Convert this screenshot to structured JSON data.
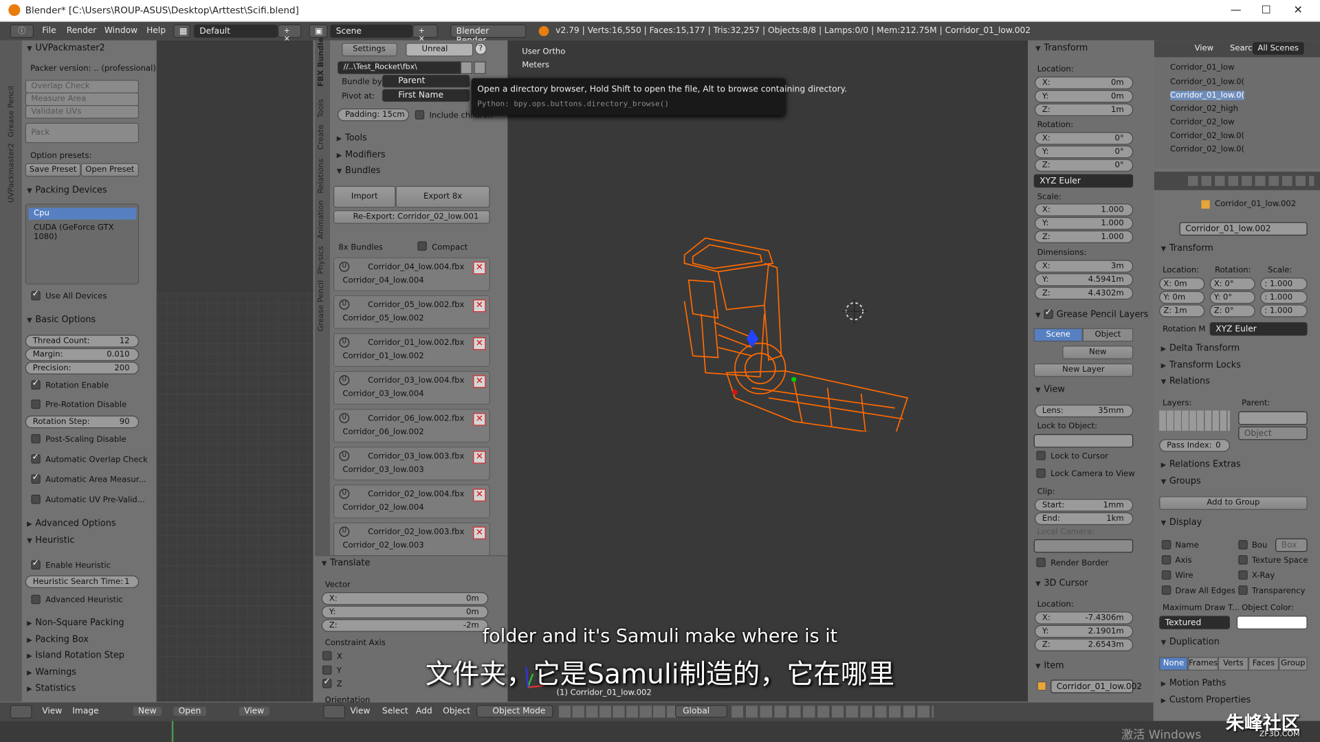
{
  "window": {
    "title": "Blender* [C:\\Users\\ROUP-ASUS\\Desktop\\Arttest\\Scifi.blend]",
    "min": "—",
    "max": "☐",
    "close": "✕"
  },
  "infobar": {
    "menus": [
      "File",
      "Render",
      "Window",
      "Help"
    ],
    "layout": "Default",
    "scene": "Scene",
    "engine": "Blender Render",
    "stats": "v2.79 | Verts:16,550 | Faces:15,177 | Tris:32,257 | Objects:8/8 | Lamps:0/0 | Mem:212.75M | Corridor_01_low.002"
  },
  "left_tabs": [
    "Grease Pencil",
    "UVPackmaster2"
  ],
  "uvp": {
    "title": "UVPackmaster2",
    "version": "Packer version: .. (professional)",
    "btns": [
      "Overlap Check",
      "Measure Area",
      "Validate UVs",
      "Pack"
    ],
    "presets_label": "Option presets:",
    "save_preset": "Save Preset",
    "open_preset": "Open Preset",
    "packing_devices": "Packing Devices",
    "devices": [
      "Cpu",
      "CUDA (GeForce GTX 1080)"
    ],
    "use_all": "Use All Devices",
    "basic": "Basic Options",
    "thread_label": "Thread Count:",
    "thread": "12",
    "margin_label": "Margin:",
    "margin": "0.010",
    "precision_label": "Precision:",
    "precision": "200",
    "rot_enable": "Rotation Enable",
    "prerot": "Pre-Rotation Disable",
    "rotstep_label": "Rotation Step:",
    "rotstep": "90",
    "postscale": "Post-Scaling Disable",
    "auto_overlap": "Automatic Overlap Check",
    "auto_area": "Automatic Area Measur...",
    "auto_uv": "Automatic UV Pre-Valid...",
    "advanced": "Advanced Options",
    "heuristic": "Heuristic",
    "enable_heur": "Enable Heuristic",
    "heur_time_label": "Heuristic Search Time:",
    "heur_time": "1",
    "adv_heur": "Advanced Heuristic",
    "collapsed": [
      "Non-Square Packing",
      "Packing Box",
      "Island Rotation Step",
      "Warnings",
      "Statistics"
    ]
  },
  "mid_tabs": [
    "FBX Bundle",
    "Tools",
    "Create",
    "Relations",
    "Animation",
    "Physics",
    "Grease Pencil"
  ],
  "fbx": {
    "settings": "Settings",
    "target": "Unreal",
    "path": "//..\\Test_Rocket\\fbx\\",
    "bundle_by_label": "Bundle by:",
    "bundle_by": "Parent",
    "pivot_label": "Pivot at:",
    "pivot": "First Name",
    "padding": "Padding: 15cm",
    "include_children": "Include children",
    "tools": "Tools",
    "modifiers": "Modifiers",
    "bundles": "Bundles",
    "import": "Import",
    "export": "Export 8x",
    "reexport": "Re-Export: Corridor_02_low.001",
    "count": "8x Bundles",
    "compact": "Compact",
    "items": [
      {
        "file": "Corridor_04_low.004.fbx",
        "obj": "Corridor_04_low.004"
      },
      {
        "file": "Corridor_05_low.002.fbx",
        "obj": "Corridor_05_low.002"
      },
      {
        "file": "Corridor_01_low.002.fbx",
        "obj": "Corridor_01_low.002"
      },
      {
        "file": "Corridor_03_low.004.fbx",
        "obj": "Corridor_03_low.004"
      },
      {
        "file": "Corridor_06_low.002.fbx",
        "obj": "Corridor_06_low.002"
      },
      {
        "file": "Corridor_03_low.003.fbx",
        "obj": "Corridor_03_low.003"
      },
      {
        "file": "Corridor_02_low.004.fbx",
        "obj": "Corridor_02_low.004"
      },
      {
        "file": "Corridor_02_low.003.fbx",
        "obj": "Corridor_02_low.003"
      }
    ]
  },
  "translate": {
    "title": "Translate",
    "vector": "Vector",
    "x_label": "X:",
    "x": "0m",
    "y_label": "Y:",
    "y": "0m",
    "z_label": "Z:",
    "z": "-2m",
    "constraint": "Constraint Axis",
    "cx": "X",
    "cy": "Y",
    "cz": "Z",
    "orientation": "Orientation"
  },
  "tooltip": {
    "text": "Open a directory browser, Hold Shift to open the file, Alt to browse containing directory.",
    "python": "Python: bpy.ops.buttons.directory_browse()"
  },
  "viewport": {
    "view_name": "User Ortho",
    "units": "Meters",
    "object_label": "(1) Corridor_01_low.002"
  },
  "subtitles": {
    "en": "folder and it's Samuli make where is it",
    "zh": "文件夹，它是Samuli制造的，它在哪里"
  },
  "npanel": {
    "transform": "Transform",
    "location": "Location:",
    "loc": [
      "0m",
      "0m",
      "1m"
    ],
    "rotation": "Rotation:",
    "rot": [
      "0°",
      "0°",
      "0°"
    ],
    "rot_mode": "XYZ Euler",
    "scale": "Scale:",
    "scl": [
      "1.000",
      "1.000",
      "1.000"
    ],
    "dimensions": "Dimensions:",
    "dim": [
      "3m",
      "4.5941m",
      "4.4302m"
    ],
    "gp_layers": "Grease Pencil Layers",
    "gp_scene": "Scene",
    "gp_object": "Object",
    "gp_new": "New",
    "gp_new_layer": "New Layer",
    "view": "View",
    "lens": "Lens:",
    "lens_v": "35mm",
    "lock_obj": "Lock to Object:",
    "lock_cursor": "Lock to Cursor",
    "lock_cam": "Lock Camera to View",
    "clip": "Clip:",
    "clip_start": "Start:",
    "clip_start_v": "1mm",
    "clip_end": "End:",
    "clip_end_v": "1km",
    "local_cam": "Local Camera:",
    "render_border": "Render Border",
    "cursor": "3D Cursor",
    "cursor_loc": "Location:",
    "cur": [
      "-7.4306m",
      "2.1901m",
      "2.6543m"
    ],
    "item": "Item",
    "item_name": "Corridor_01_low.002"
  },
  "outliner": {
    "view": "View",
    "search": "Search",
    "all_scenes": "All Scenes",
    "items": [
      "Corridor_01_low",
      "Corridor_01_low.0(",
      "Corridor_01_low.0(",
      "Corridor_02_high",
      "Corridor_02_low",
      "Corridor_02_low.0(",
      "Corridor_02_low.0("
    ]
  },
  "props": {
    "breadcrumb": "Corridor_01_low.002",
    "name": "Corridor_01_low.002",
    "transform": "Transform",
    "location": "Location:",
    "rotation": "Rotation:",
    "scale": "Scale:",
    "loc": [
      "X: 0m",
      "Y: 0m",
      "Z: 1m"
    ],
    "rot": [
      "X: 0°",
      "Y: 0°",
      "Z: 0°"
    ],
    "scl": [
      ": 1.000",
      ": 1.000",
      ": 1.000"
    ],
    "rotmode_label": "Rotation M",
    "rotmode": "XYZ Euler",
    "delta": "Delta Transform",
    "locks": "Transform Locks",
    "relations": "Relations",
    "layers": "Layers:",
    "parent": "Parent:",
    "parent_type": "Object",
    "pass_index": "Pass Index:",
    "pass_index_v": "0",
    "rel_extras": "Relations Extras",
    "groups": "Groups",
    "add_group": "Add to Group",
    "display": "Display",
    "d_name": "Name",
    "d_bou": "Bou",
    "d_box": "Box",
    "d_axis": "Axis",
    "d_texspace": "Texture Space",
    "d_wire": "Wire",
    "d_xray": "X-Ray",
    "d_alledges": "Draw All Edges",
    "d_transp": "Transparency",
    "maxdraw": "Maximum Draw T...",
    "objcolor": "Object Color:",
    "drawtype": "Textured",
    "duplication": "Duplication",
    "dup_tabs": [
      "None",
      "Frames",
      "Verts",
      "Faces",
      "Group"
    ],
    "motion": "Motion Paths",
    "custom": "Custom Properties"
  },
  "uv_bottom": {
    "view": "View",
    "image": "Image",
    "new": "New",
    "open": "Open",
    "view2": "View"
  },
  "v3d_bottom": {
    "view": "View",
    "select": "Select",
    "add": "Add",
    "object": "Object",
    "mode": "Object Mode",
    "orient": "Global"
  },
  "watermark": {
    "windows": "激活 Windows",
    "brand": "朱峰社区",
    "site": "ZF3D.COM"
  },
  "colors": {
    "accent": "#5680c2",
    "selection": "#ff6a00"
  }
}
